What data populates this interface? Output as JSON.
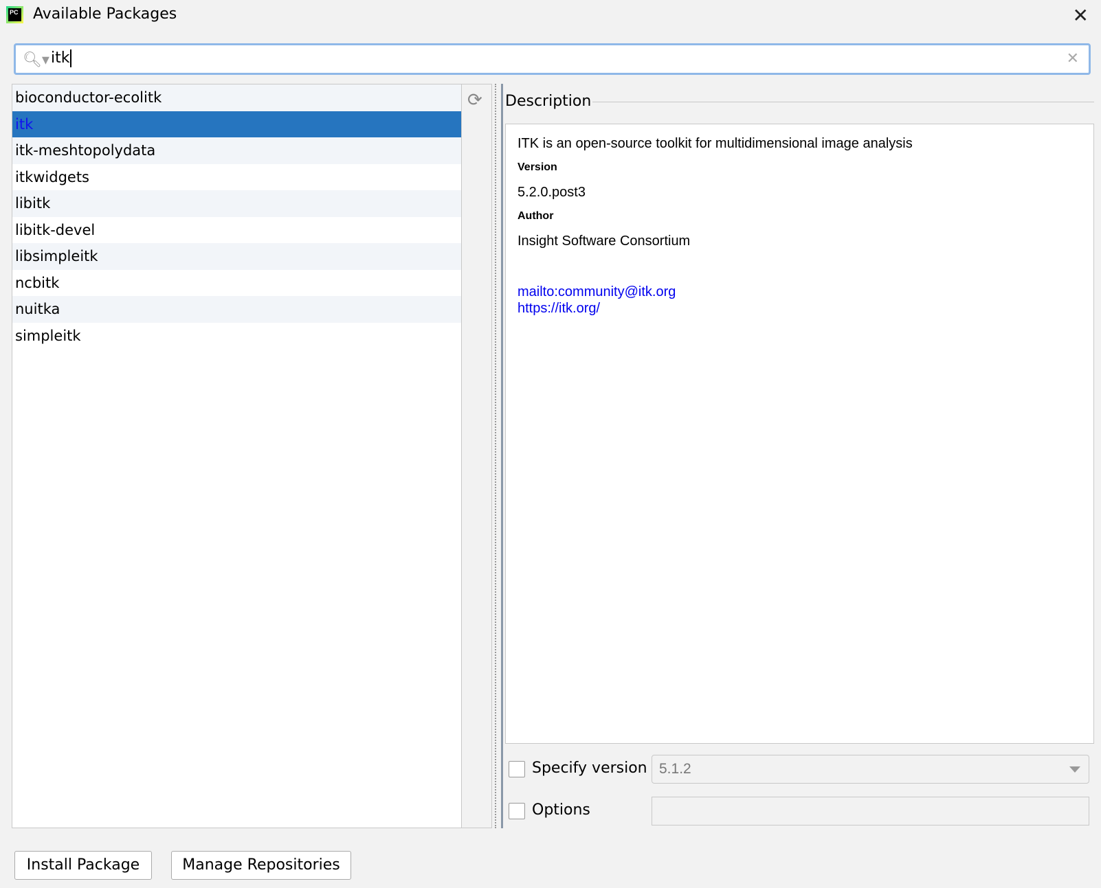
{
  "window": {
    "title": "Available Packages",
    "logo_text": "PC"
  },
  "search": {
    "value": "itk"
  },
  "packages": [
    {
      "name": "bioconductor-ecolitk"
    },
    {
      "name": "itk",
      "selected": true
    },
    {
      "name": "itk-meshtopolydata"
    },
    {
      "name": "itkwidgets"
    },
    {
      "name": "libitk"
    },
    {
      "name": "libitk-devel"
    },
    {
      "name": "libsimpleitk"
    },
    {
      "name": "ncbitk"
    },
    {
      "name": "nuitka"
    },
    {
      "name": "simpleitk"
    }
  ],
  "description": {
    "title": "Description",
    "summary": "ITK is an open-source toolkit for multidimensional image analysis",
    "version_label": "Version",
    "version": "5.2.0.post3",
    "author_label": "Author",
    "author": "Insight Software Consortium",
    "links": [
      "mailto:community@itk.org",
      "https://itk.org/"
    ]
  },
  "specify_version": {
    "label": "Specify version",
    "checked": false,
    "value": "5.1.2"
  },
  "options": {
    "label": "Options",
    "checked": false,
    "value": ""
  },
  "buttons": {
    "install": "Install Package",
    "manage": "Manage Repositories"
  }
}
